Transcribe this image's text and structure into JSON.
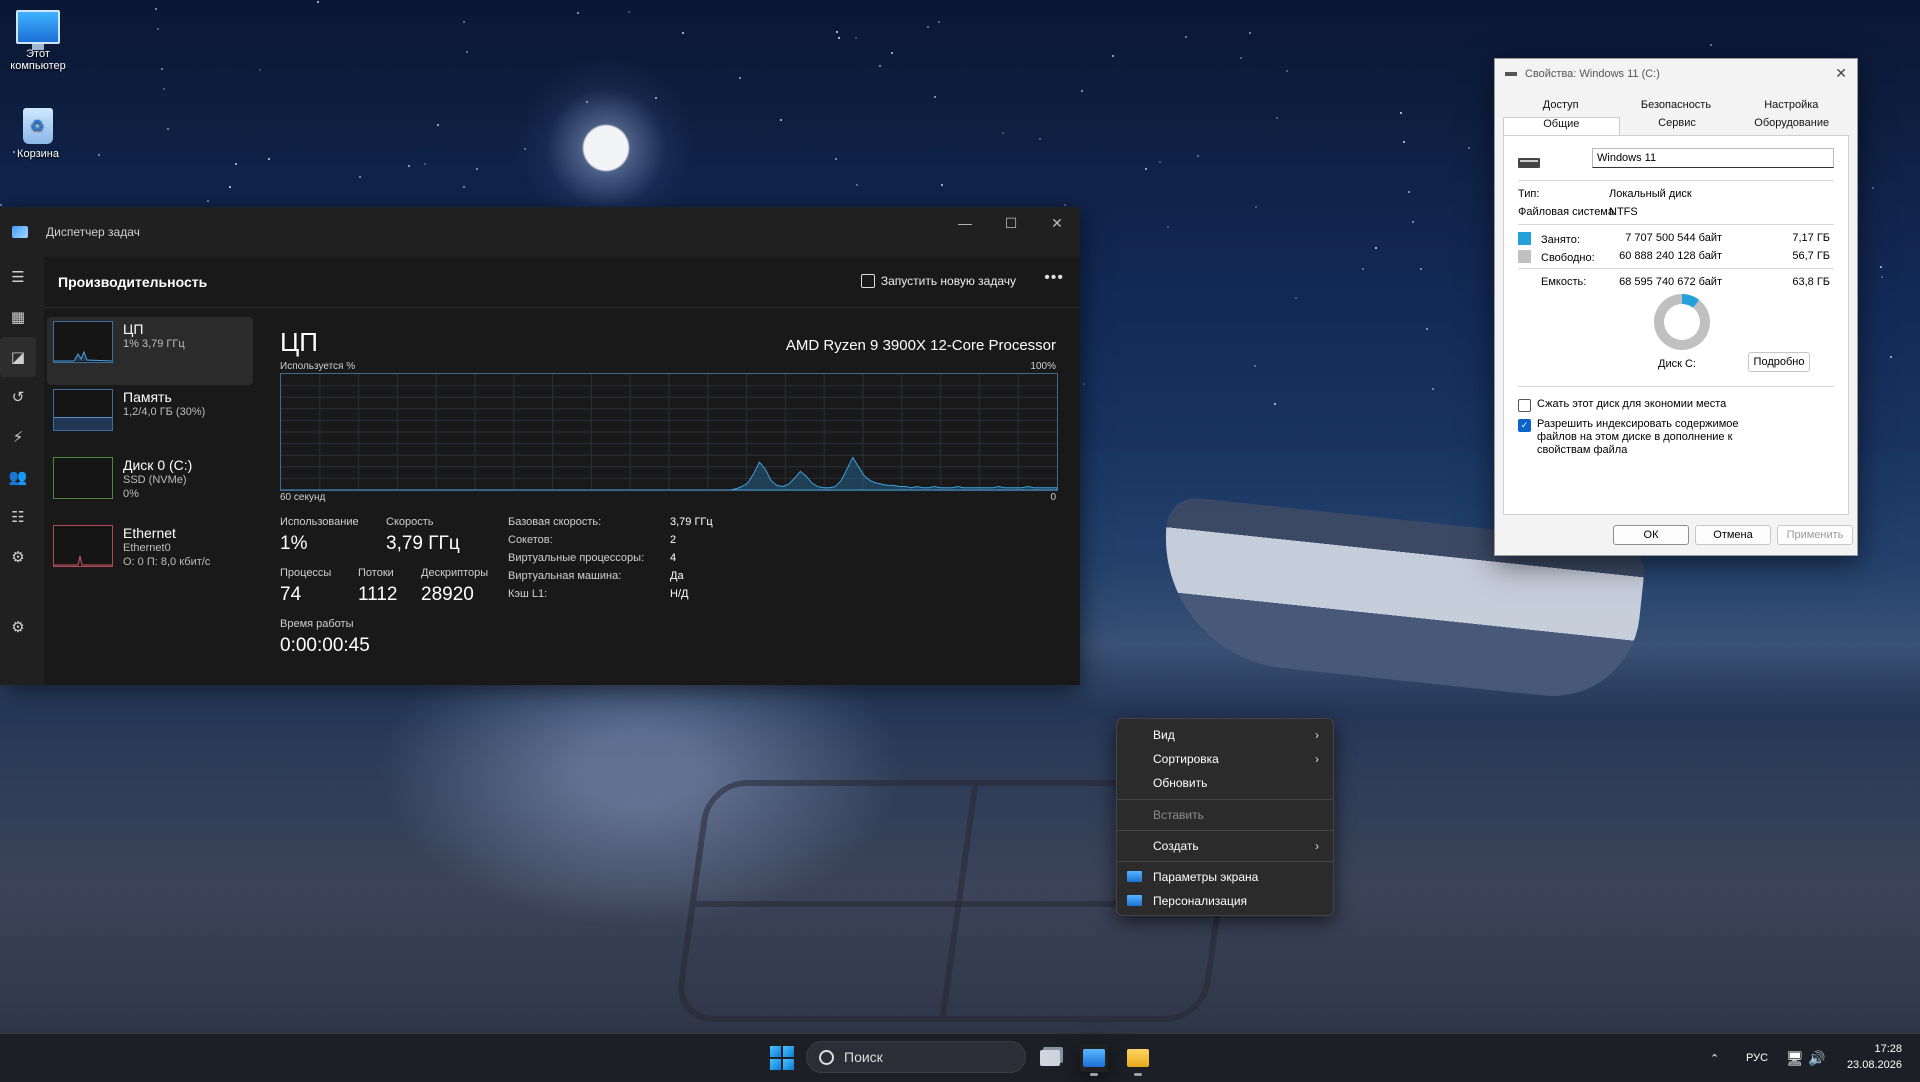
{
  "desktop": {
    "icons": [
      {
        "label": "Этот компьютер"
      },
      {
        "label": "Корзина"
      }
    ]
  },
  "task_manager": {
    "title": "Диспетчер задач",
    "header_title": "Производительность",
    "new_task_label": "Запустить новую задачу",
    "more_label": "•••",
    "items": [
      {
        "name": "ЦП",
        "sub1": "1% 3,79 ГГц",
        "sub2": "",
        "sub3": ""
      },
      {
        "name": "Память",
        "sub1": "1,2/4,0 ГБ (30%)",
        "sub2": "",
        "sub3": ""
      },
      {
        "name": "Диск 0 (C:)",
        "sub1": "SSD (NVMe)",
        "sub2": "0%",
        "sub3": ""
      },
      {
        "name": "Ethernet",
        "sub1": "Ethernet0",
        "sub2": "О: 0 П: 8,0 кбит/с",
        "sub3": ""
      }
    ],
    "cpu": {
      "heading": "ЦП",
      "model": "AMD Ryzen 9 3900X 12-Core Processor",
      "util_label": "Используется %",
      "util_max": "100%",
      "seconds_label": "60 секунд",
      "zero_label": "0",
      "graph_values": [
        0,
        0,
        0,
        0,
        0,
        0,
        0,
        0,
        0,
        0,
        0,
        0,
        0,
        0,
        0,
        0,
        0,
        0,
        0,
        0,
        0,
        0,
        0,
        0,
        0,
        0,
        0,
        0,
        0,
        0,
        0,
        0,
        0,
        0,
        0,
        0,
        0,
        0,
        0,
        0,
        0,
        0,
        0,
        0,
        0,
        0,
        0,
        0,
        0,
        0,
        0,
        0,
        0,
        0,
        0,
        0,
        0,
        0,
        0,
        0,
        0,
        0,
        0,
        0,
        0,
        0,
        0,
        0,
        0,
        0,
        0,
        0,
        0,
        0,
        0,
        0,
        0,
        0,
        1,
        3,
        6,
        14,
        24,
        18,
        8,
        4,
        3,
        5,
        10,
        16,
        12,
        6,
        3,
        2,
        2,
        3,
        8,
        18,
        28,
        20,
        12,
        8,
        6,
        5,
        4,
        4,
        3,
        3,
        2,
        3,
        2,
        2,
        3,
        2,
        2,
        2,
        3,
        2,
        2,
        2,
        2,
        2,
        2,
        3,
        2,
        2,
        2,
        2,
        3,
        2,
        2,
        2,
        2,
        2
      ],
      "usage_label": "Использование",
      "usage_value": "1%",
      "speed_label": "Скорость",
      "speed_value": "3,79 ГГц",
      "processes_label": "Процессы",
      "processes_value": "74",
      "threads_label": "Потоки",
      "threads_value": "1112",
      "handles_label": "Дескрипторы",
      "handles_value": "28920",
      "uptime_label": "Время работы",
      "uptime_value": "0:00:00:45",
      "specs": [
        {
          "k": "Базовая скорость:",
          "v": "3,79 ГГц"
        },
        {
          "k": "Сокетов:",
          "v": "2"
        },
        {
          "k": "Виртуальные процессоры:",
          "v": "4"
        },
        {
          "k": "Виртуальная машина:",
          "v": "Да"
        },
        {
          "k": "Кэш L1:",
          "v": "Н/Д"
        }
      ]
    }
  },
  "properties": {
    "title": "Свойства: Windows 11 (C:)",
    "tabs_top": [
      "Доступ",
      "Безопасность",
      "Настройка"
    ],
    "tabs_bottom": [
      "Общие",
      "Сервис",
      "Оборудование"
    ],
    "drive_name": "Windows 11",
    "type_label": "Тип:",
    "type_value": "Локальный диск",
    "fs_label": "Файловая система:",
    "fs_value": "NTFS",
    "used_label": "Занято:",
    "used_bytes": "7 707 500 544 байт",
    "used_gb": "7,17 ГБ",
    "free_label": "Свободно:",
    "free_bytes": "60 888 240 128 байт",
    "free_gb": "56,7 ГБ",
    "cap_label": "Емкость:",
    "cap_bytes": "68 595 740 672 байт",
    "cap_gb": "63,8 ГБ",
    "used_fraction": 0.105,
    "used_color": "#26a0da",
    "free_color": "#c0c0c0",
    "disk_label": "Диск C:",
    "details_button": "Подробно",
    "compress_label": "Сжать этот диск для экономии места",
    "compress_checked": false,
    "index_label": "Разрешить индексировать содержимое файлов на этом диске в дополнение к свойствам файла",
    "index_checked": true,
    "ok": "ОК",
    "cancel": "Отмена",
    "apply": "Применить"
  },
  "context_menu": {
    "items": [
      "Вид",
      "Сортировка",
      "Обновить",
      "Вставить",
      "Создать",
      "Параметры экрана",
      "Персонализация"
    ]
  },
  "taskbar": {
    "search_placeholder": "Поиск",
    "language": "РУС",
    "time": "17:28",
    "date": "23.08.2026"
  }
}
